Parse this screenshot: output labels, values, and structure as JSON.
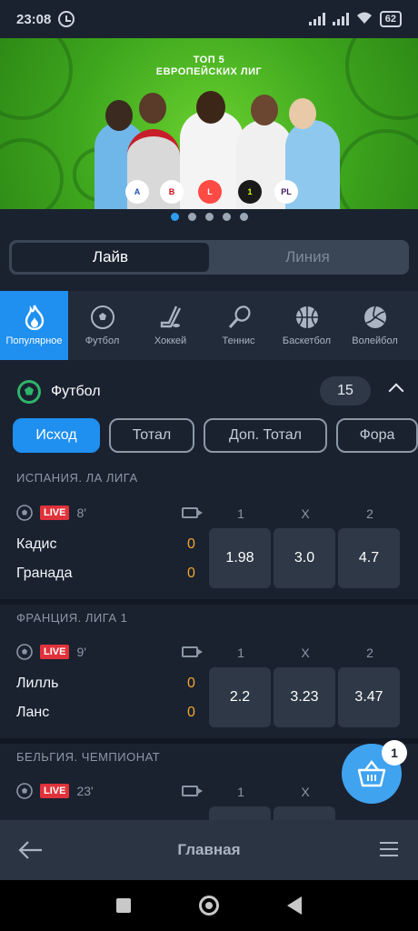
{
  "status": {
    "time": "23:08",
    "battery": "62"
  },
  "banner": {
    "title_line1": "ТОП 5",
    "title_line2": "ЕВРОПЕЙСКИХ ЛИГ",
    "slides": 5,
    "active_slide": 0
  },
  "tabs": {
    "live": "Лайв",
    "line": "Линия"
  },
  "sports": [
    {
      "label": "Популярное",
      "icon": "fire-icon"
    },
    {
      "label": "Футбол",
      "icon": "soccer-ball-icon"
    },
    {
      "label": "Хоккей",
      "icon": "hockey-icon"
    },
    {
      "label": "Теннис",
      "icon": "tennis-racket-icon"
    },
    {
      "label": "Баскетбол",
      "icon": "basketball-icon"
    },
    {
      "label": "Волейбол",
      "icon": "volleyball-icon"
    }
  ],
  "section": {
    "title": "Футбол",
    "count": "15"
  },
  "filters": [
    "Исход",
    "Тотал",
    "Доп. Тотал",
    "Фора"
  ],
  "columns": {
    "c1": "1",
    "cx": "X",
    "c2": "2"
  },
  "live_badge": "LIVE",
  "leagues": [
    {
      "name": "ИСПАНИЯ.  ЛА ЛИГА",
      "minute": "8'",
      "team1": "Кадис",
      "score1": "0",
      "team2": "Гранада",
      "score2": "0",
      "odds": [
        "1.98",
        "3.0",
        "4.7"
      ]
    },
    {
      "name": "ФРАНЦИЯ.  ЛИГА 1",
      "minute": "9'",
      "team1": "Лилль",
      "score1": "0",
      "team2": "Ланс",
      "score2": "0",
      "odds": [
        "2.2",
        "3.23",
        "3.47"
      ]
    },
    {
      "name": "БЕЛЬГИЯ.  ЧЕМПИОНАТ",
      "minute": "23'"
    }
  ],
  "cart": {
    "count": "1"
  },
  "bottom": {
    "title": "Главная"
  },
  "colors": {
    "accent": "#1f8ff0",
    "background": "#1a2230",
    "live": "#e0323a",
    "score": "#f1a531"
  }
}
